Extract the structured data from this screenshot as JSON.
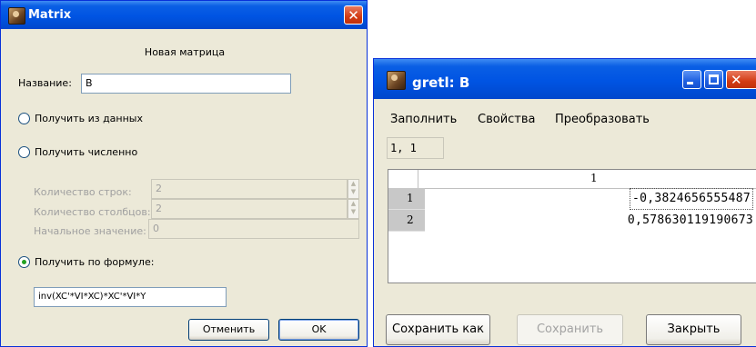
{
  "matrix_dialog": {
    "title": "Matrix",
    "header": "Новая матрица",
    "name_label": "Название:",
    "name_value": "B",
    "radio_from_data": "Получить из данных",
    "radio_numeric": "Получить численно",
    "rows_label": "Количество строк:",
    "rows_value": "2",
    "cols_label": "Количество столбцов:",
    "cols_value": "2",
    "init_label": "Начальное значение:",
    "init_value": "0",
    "radio_formula": "Получить по формуле:",
    "formula_value": "inv(XC'*VI*XC)*XC'*VI*Y",
    "selected_option": "Получить по формуле:",
    "cancel_label": "Отменить",
    "ok_label": "OK"
  },
  "gretl_window": {
    "title": "gretl: B",
    "menu": [
      "Заполнить",
      "Свойства",
      "Преобразовать"
    ],
    "cell_ref": "1, 1",
    "column_header": "1",
    "rows": [
      {
        "row": "1",
        "value": "-0,3824656555487"
      },
      {
        "row": "2",
        "value": "0,578630119190673"
      }
    ],
    "save_as_label": "Сохранить как",
    "save_label": "Сохранить",
    "close_label": "Закрыть"
  },
  "colors": {
    "titlebar_blue": "#0054e3",
    "window_bg": "#ece9d8",
    "close_red": "#d33c14"
  }
}
